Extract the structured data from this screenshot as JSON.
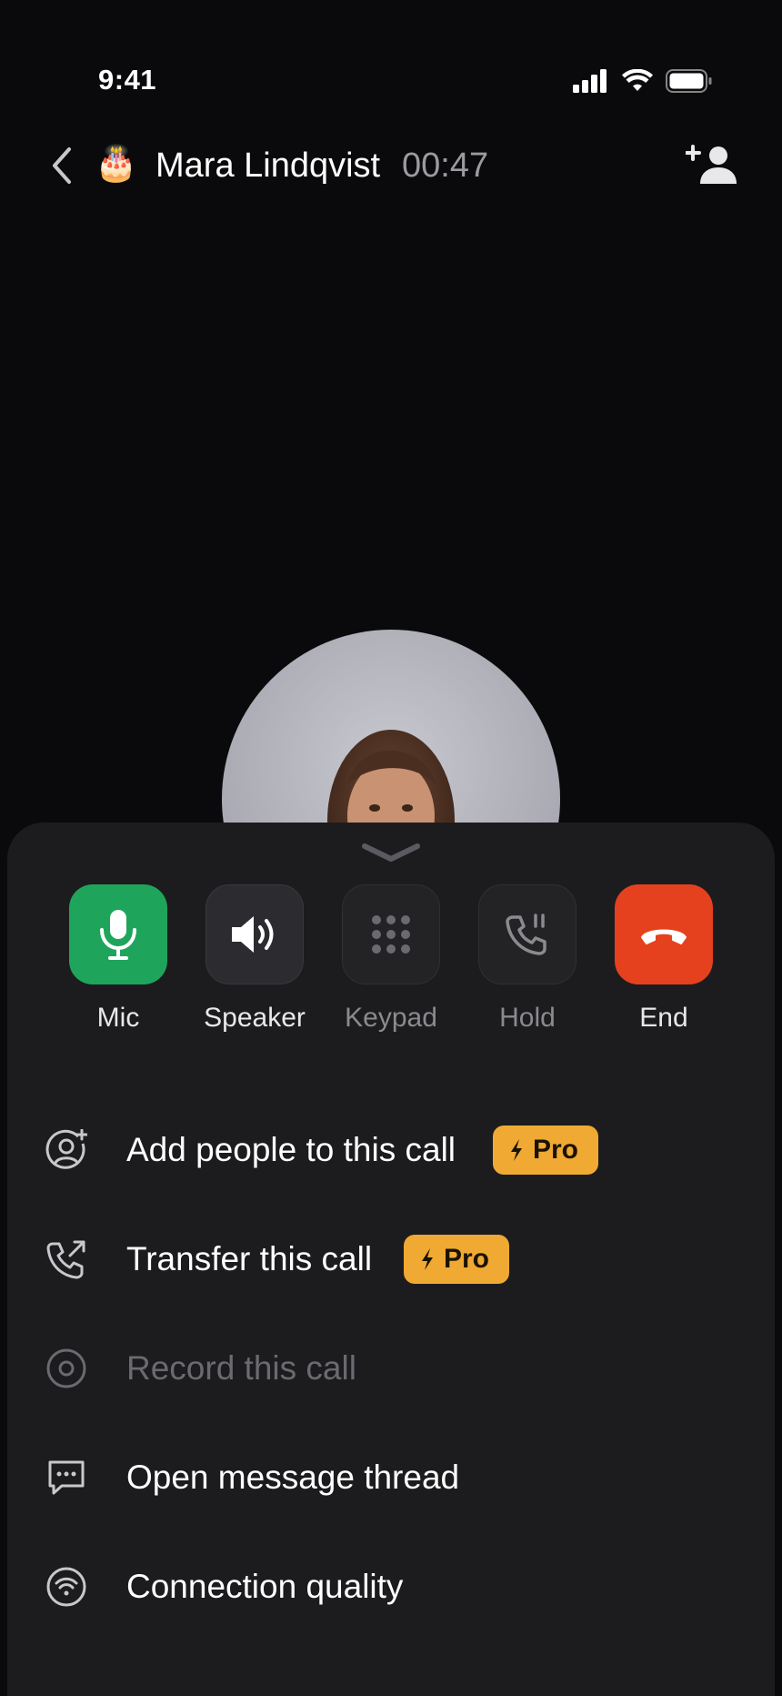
{
  "status_bar": {
    "time": "9:41"
  },
  "header": {
    "caller_emoji": "🎂",
    "caller_name": "Mara Lindqvist",
    "call_duration": "00:47"
  },
  "controls": [
    {
      "label": "Mic",
      "icon": "mic-icon",
      "state": "active",
      "color": "#1fa55b"
    },
    {
      "label": "Speaker",
      "icon": "speaker-icon",
      "state": "normal"
    },
    {
      "label": "Keypad",
      "icon": "keypad-icon",
      "state": "disabled"
    },
    {
      "label": "Hold",
      "icon": "hold-icon",
      "state": "disabled"
    },
    {
      "label": "End",
      "icon": "end-call-icon",
      "state": "danger",
      "color": "#e5411f"
    }
  ],
  "menu": [
    {
      "label": "Add people to this call",
      "icon": "add-person-circle-icon",
      "badge": "Pro",
      "enabled": true
    },
    {
      "label": "Transfer this call",
      "icon": "transfer-call-icon",
      "badge": "Pro",
      "enabled": true
    },
    {
      "label": "Record this call",
      "icon": "record-icon",
      "enabled": false
    },
    {
      "label": "Open message thread",
      "icon": "message-icon",
      "enabled": true
    },
    {
      "label": "Connection quality",
      "icon": "wifi-circle-icon",
      "enabled": true
    }
  ],
  "colors": {
    "accent_pro": "#f0a933",
    "background": "#0a0a0c",
    "sheet": "#1c1c1e"
  }
}
